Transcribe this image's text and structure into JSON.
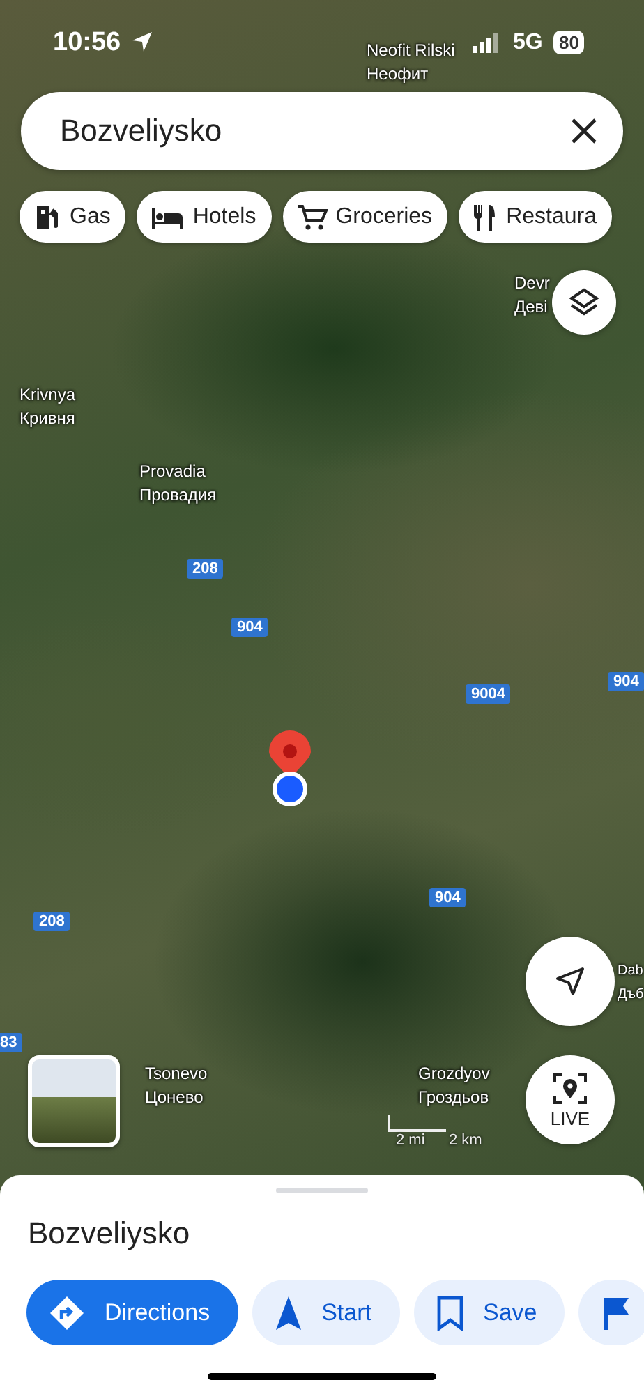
{
  "status_bar": {
    "time": "10:56",
    "network": "5G",
    "battery": "80"
  },
  "search": {
    "value": "Bozveliysko"
  },
  "chips": [
    {
      "label": "Gas",
      "kind": "gas"
    },
    {
      "label": "Hotels",
      "kind": "hotel"
    },
    {
      "label": "Groceries",
      "kind": "grocery"
    },
    {
      "label": "Restaura",
      "kind": "restaurant"
    }
  ],
  "map": {
    "places": [
      {
        "name": "Neofit Rilski",
        "name_local": "Неофит"
      },
      {
        "name": "Devr",
        "name_local": "Деві"
      },
      {
        "name": "Krivnya",
        "name_local": "Кривня"
      },
      {
        "name": "Provadia",
        "name_local": "Провадия"
      },
      {
        "name": "Tsonevo",
        "name_local": "Цонево"
      },
      {
        "name": "Grozdyov",
        "name_local": "Гроздьов"
      },
      {
        "name": "Dab",
        "name_local": "Дъб"
      }
    ],
    "roads": [
      "208",
      "904",
      "9004",
      "904",
      "208",
      "904",
      "83"
    ],
    "scale": {
      "imperial": "2 mi",
      "metric": "2 km"
    },
    "live_label": "LIVE"
  },
  "place_sheet": {
    "title": "Bozveliysko",
    "actions": [
      {
        "label": "Directions",
        "kind": "directions",
        "primary": true
      },
      {
        "label": "Start",
        "kind": "start",
        "primary": false
      },
      {
        "label": "Save",
        "kind": "save",
        "primary": false
      },
      {
        "kind": "flag",
        "primary": false
      }
    ]
  }
}
